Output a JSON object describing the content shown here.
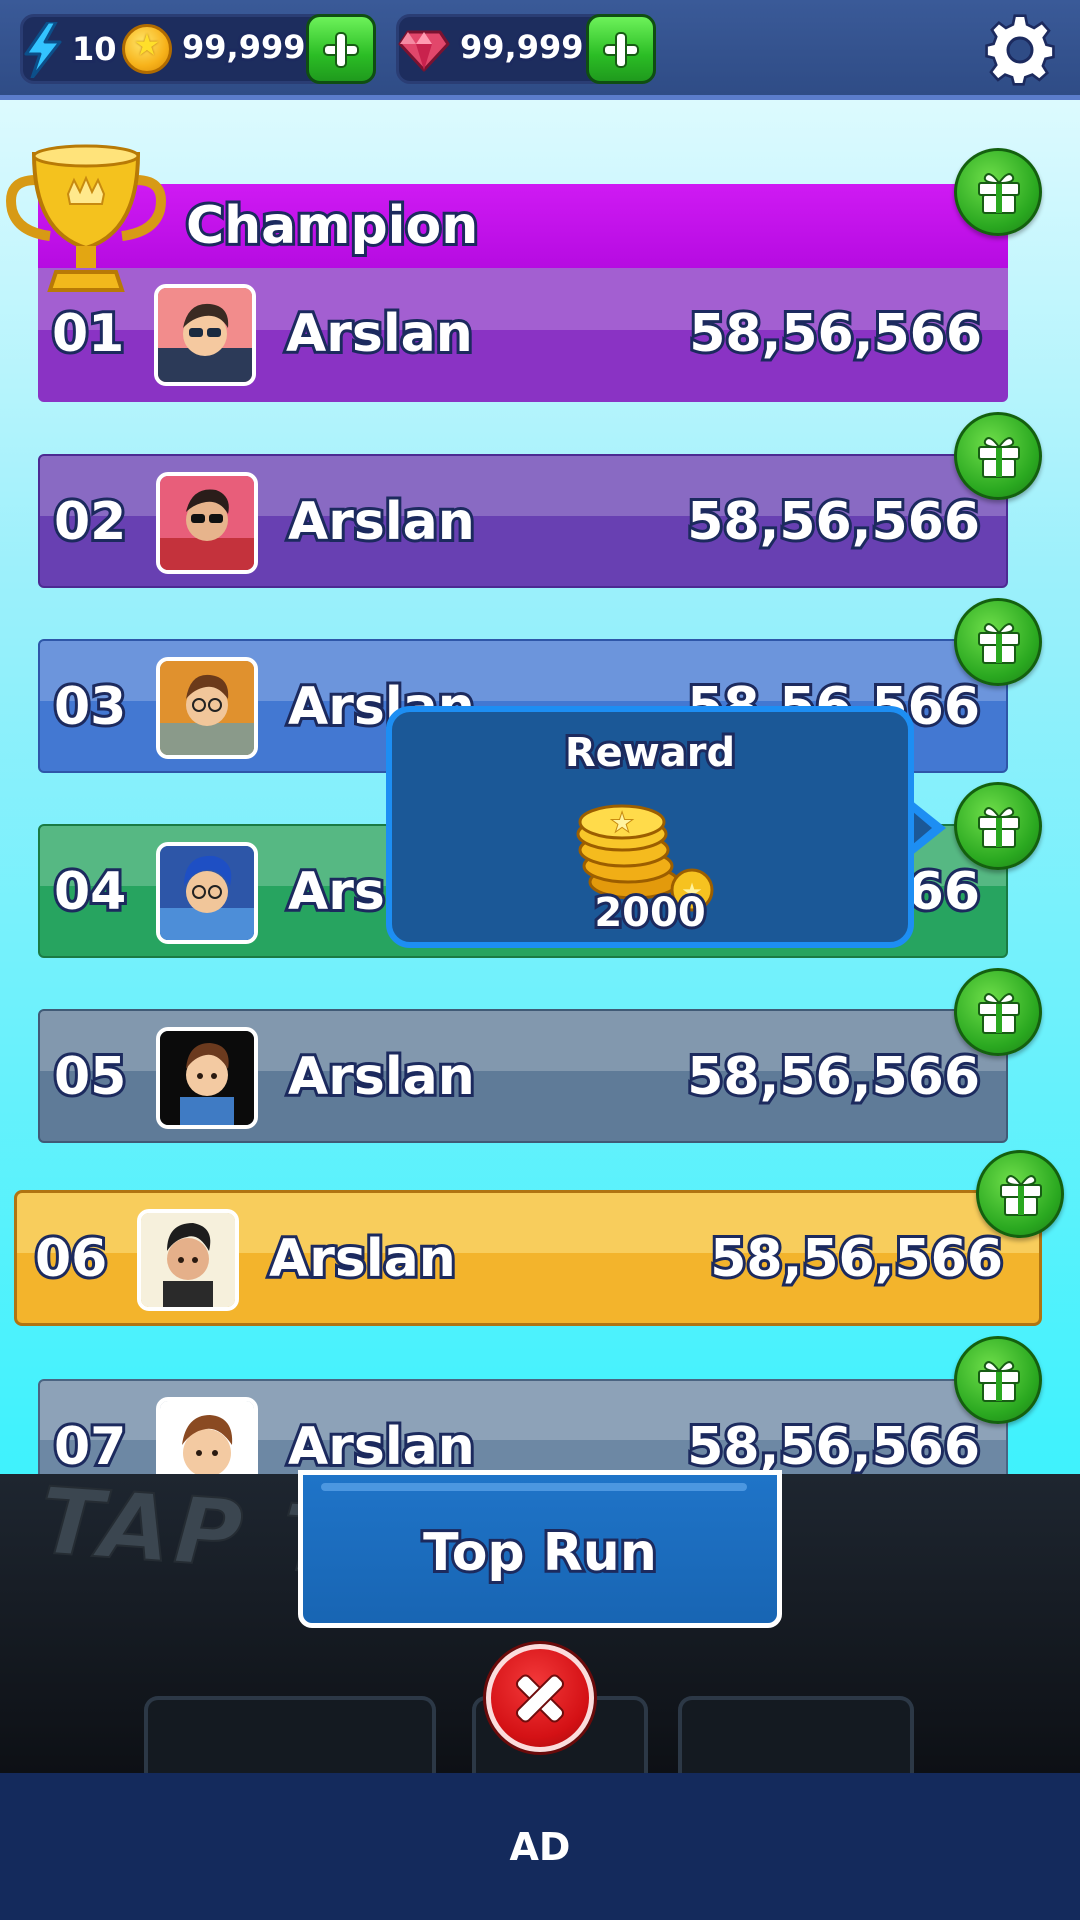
{
  "topbar": {
    "energy": "10",
    "coins": "99,999",
    "gems": "99,999"
  },
  "leaderboard": {
    "title": "Champion",
    "rows": [
      {
        "rank": "01",
        "name": "Arslan",
        "score": "58,56,566"
      },
      {
        "rank": "02",
        "name": "Arslan",
        "score": "58,56,566"
      },
      {
        "rank": "03",
        "name": "Arslan",
        "score": "58,56,566"
      },
      {
        "rank": "04",
        "name": "Arslan",
        "score": "58,56,566"
      },
      {
        "rank": "05",
        "name": "Arslan",
        "score": "58,56,566"
      },
      {
        "rank": "06",
        "name": "Arslan",
        "score": "58,56,566"
      },
      {
        "rank": "07",
        "name": "Arslan",
        "score": "58,56,566"
      }
    ]
  },
  "reward_popup": {
    "title": "Reward",
    "amount": "2000"
  },
  "bottom": {
    "background_text": "TAP T",
    "top_run_label": "Top Run",
    "ad_label": "AD"
  },
  "colors": {
    "topbar": "#2f4c86",
    "champion_banner": "#c612ea",
    "row_01": "#8a33c4",
    "row_02": "#6840b2",
    "row_03": "#4378d2",
    "row_04": "#27a460",
    "row_05": "#5f7b98",
    "row_06_highlight": "#f3b42c",
    "row_07": "#6d88a4",
    "gift_button": "#2aa820",
    "close_button": "#d41115",
    "ad_bar": "#142a5c"
  },
  "icons": [
    "lightning-icon",
    "coin-icon",
    "gem-icon",
    "plus-icon",
    "gear-icon",
    "trophy-icon",
    "gift-icon",
    "close-icon"
  ]
}
